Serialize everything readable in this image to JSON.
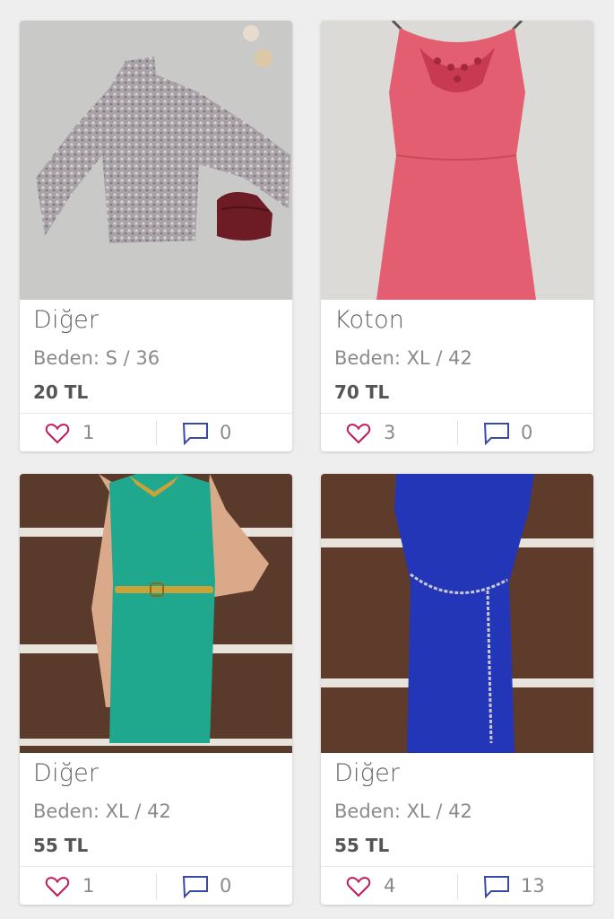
{
  "colors": {
    "heart": "#c2185b",
    "comment": "#3949ab",
    "background": "#eeeeee"
  },
  "products": [
    {
      "brand": "Diğer",
      "size": "Beden: S / 36",
      "price": "20 TL",
      "likes": "1",
      "comments": "0",
      "photo": "floral-sweater-with-handbag"
    },
    {
      "brand": "Koton",
      "size": "Beden: XL / 42",
      "price": "70 TL",
      "likes": "3",
      "comments": "0",
      "photo": "coral-pink-dress"
    },
    {
      "brand": "Diğer",
      "size": "Beden: XL / 42",
      "price": "55 TL",
      "likes": "1",
      "comments": "0",
      "photo": "green-dress-with-belt"
    },
    {
      "brand": "Diğer",
      "size": "Beden: XL / 42",
      "price": "55 TL",
      "likes": "4",
      "comments": "13",
      "photo": "royal-blue-dress-with-chain"
    }
  ]
}
